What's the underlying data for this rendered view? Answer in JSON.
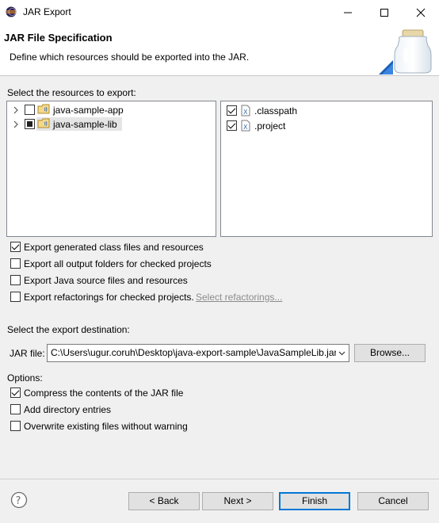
{
  "window": {
    "title": "JAR Export"
  },
  "header": {
    "title": "JAR File Specification",
    "description": "Define which resources should be exported into the JAR."
  },
  "resources": {
    "label": "Select the resources to export:",
    "projects": [
      {
        "name": "java-sample-app",
        "checked": false,
        "state": "unchecked"
      },
      {
        "name": "java-sample-lib",
        "checked": true,
        "state": "partial",
        "selected": true
      }
    ],
    "files": [
      {
        "name": ".classpath",
        "checked": true
      },
      {
        "name": ".project",
        "checked": true
      }
    ]
  },
  "export_options": {
    "generated_class": {
      "label": "Export generated class files and resources",
      "checked": true
    },
    "output_folders": {
      "label": "Export all output folders for checked projects",
      "checked": false
    },
    "java_source": {
      "label": "Export Java source files and resources",
      "checked": false
    },
    "refactorings": {
      "label": "Export refactorings for checked projects.",
      "checked": false,
      "link": "Select refactorings..."
    }
  },
  "destination": {
    "label": "Select the export destination:",
    "jar_file_label": "JAR file:",
    "jar_file_value": "C:\\Users\\ugur.coruh\\Desktop\\java-export-sample\\JavaSampleLib.jar",
    "browse_label": "Browse..."
  },
  "options": {
    "label": "Options:",
    "compress": {
      "label": "Compress the contents of the JAR file",
      "checked": true
    },
    "directory_entries": {
      "label": "Add directory entries",
      "checked": false
    },
    "overwrite": {
      "label": "Overwrite existing files without warning",
      "checked": false
    }
  },
  "buttons": {
    "back": "< Back",
    "next": "Next >",
    "finish": "Finish",
    "cancel": "Cancel"
  }
}
